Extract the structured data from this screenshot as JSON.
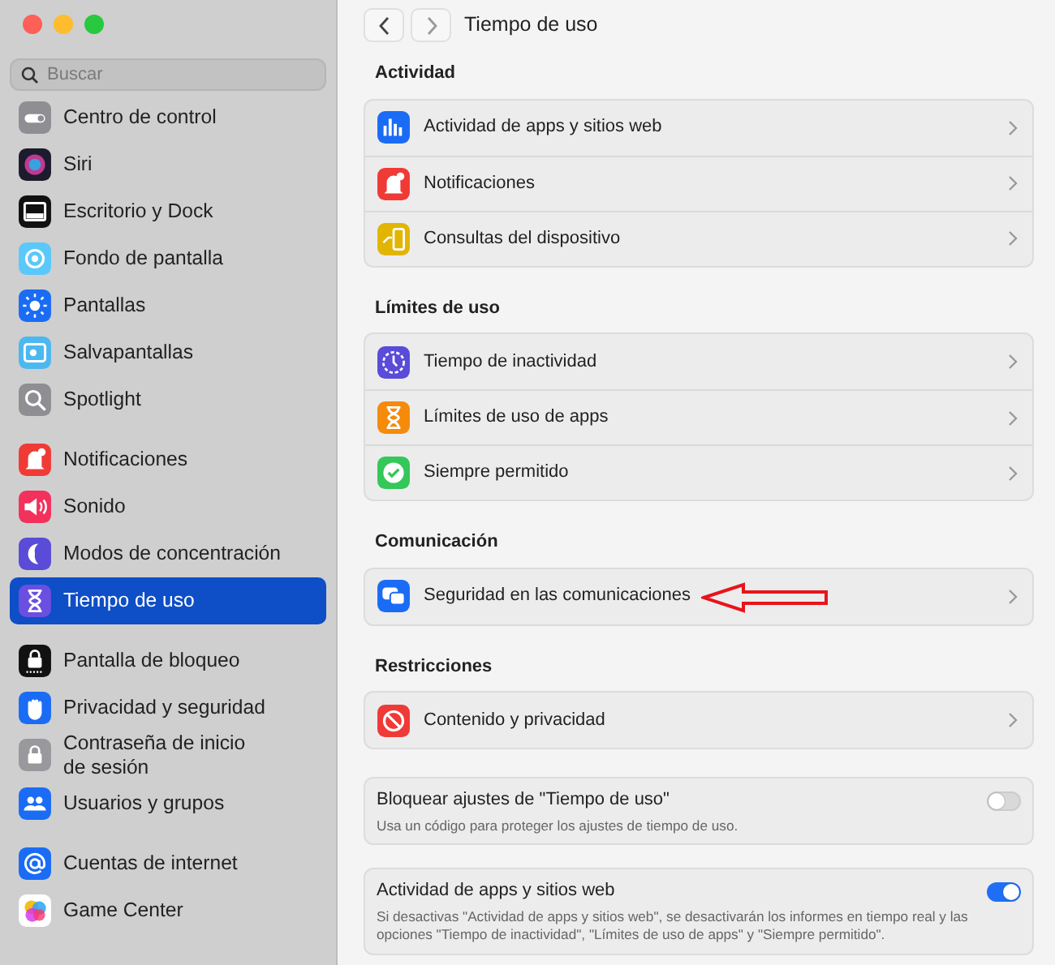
{
  "sidebar": {
    "search": {
      "placeholder": "Buscar"
    },
    "groups": [
      [
        {
          "label": "Centro de control",
          "selected": false
        },
        {
          "label": "Siri",
          "selected": false
        },
        {
          "label": "Escritorio y Dock",
          "selected": false
        },
        {
          "label": "Fondo de pantalla",
          "selected": false
        },
        {
          "label": "Pantallas",
          "selected": false
        },
        {
          "label": "Salvapantallas",
          "selected": false
        },
        {
          "label": "Spotlight",
          "selected": false
        }
      ],
      [
        {
          "label": "Notificaciones",
          "selected": false
        },
        {
          "label": "Sonido",
          "selected": false
        },
        {
          "label": "Modos de concentración",
          "selected": false
        },
        {
          "label": "Tiempo de uso",
          "selected": true
        }
      ],
      [
        {
          "label": "Pantalla de bloqueo",
          "selected": false
        },
        {
          "label": "Privacidad y seguridad",
          "selected": false
        },
        {
          "label": "Contraseña de inicio de sesión",
          "selected": false
        },
        {
          "label": "Usuarios y grupos",
          "selected": false
        }
      ],
      [
        {
          "label": "Cuentas de internet",
          "selected": false
        },
        {
          "label": "Game Center",
          "selected": false
        }
      ]
    ]
  },
  "toolbar": {
    "title": "Tiempo de uso"
  },
  "sections": [
    {
      "heading": "Actividad",
      "rows": [
        {
          "label": "Actividad de apps y sitios web"
        },
        {
          "label": "Notificaciones"
        },
        {
          "label": "Consultas del dispositivo"
        }
      ]
    },
    {
      "heading": "Límites de uso",
      "rows": [
        {
          "label": "Tiempo de inactividad"
        },
        {
          "label": "Límites de uso de apps"
        },
        {
          "label": "Siempre permitido"
        }
      ]
    },
    {
      "heading": "Comunicación",
      "rows": [
        {
          "label": "Seguridad en las comunicaciones",
          "annotated": true
        }
      ]
    },
    {
      "heading": "Restricciones",
      "rows": [
        {
          "label": "Contenido y privacidad"
        }
      ]
    }
  ],
  "toggles": [
    {
      "title": "Bloquear ajustes de \"Tiempo de uso\"",
      "description": "Usa un código para proteger los ajustes de tiempo de uso.",
      "on": false
    },
    {
      "title": "Actividad de apps y sitios web",
      "description": "Si desactivas \"Actividad de apps y sitios web\", se desactivarán los informes en tiempo real y las opciones \"Tiempo de inactividad\", \"Límites de uso de apps\" y \"Siempre permitido\".",
      "on": true
    }
  ]
}
